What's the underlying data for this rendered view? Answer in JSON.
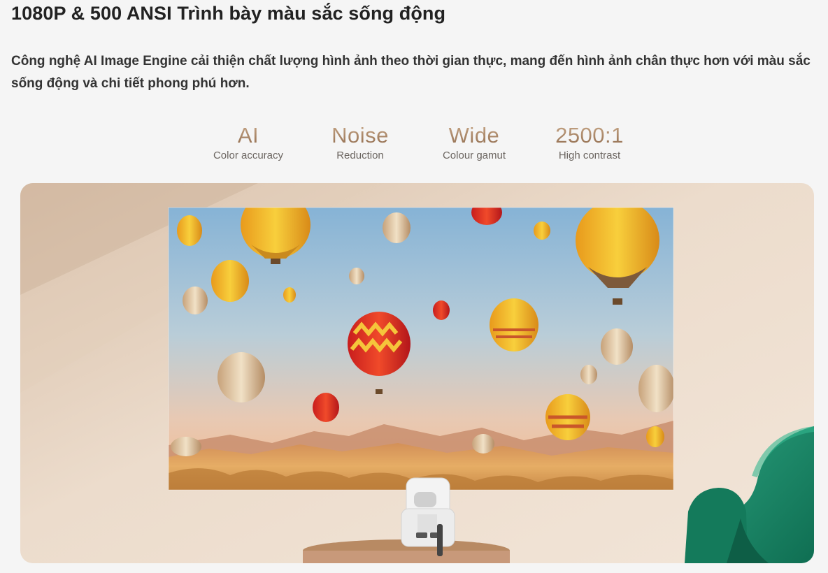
{
  "page": {
    "heading": "1080P & 500 ANSI Trình bày màu sắc sống động",
    "description": "Công nghệ AI Image Engine cải thiện chất lượng hình ảnh theo thời gian thực, mang đến hình ảnh chân thực hơn với màu sắc sống động và chi tiết phong phú hơn."
  },
  "features": [
    {
      "big": "AI",
      "small": "Color accuracy"
    },
    {
      "big": "Noise",
      "small": "Reduction"
    },
    {
      "big": "Wide",
      "small": "Colour gamut"
    },
    {
      "big": "2500:1",
      "small": "High contrast"
    }
  ],
  "colors": {
    "page_background": "#f5f5f5",
    "feature_gold": "#b49271",
    "wall": "#e9d6c3",
    "armchair": "#1f8a6a"
  },
  "scene": {
    "icons": [
      "hot-air-balloon-icon",
      "projector-icon",
      "armchair-icon",
      "table-icon"
    ]
  }
}
